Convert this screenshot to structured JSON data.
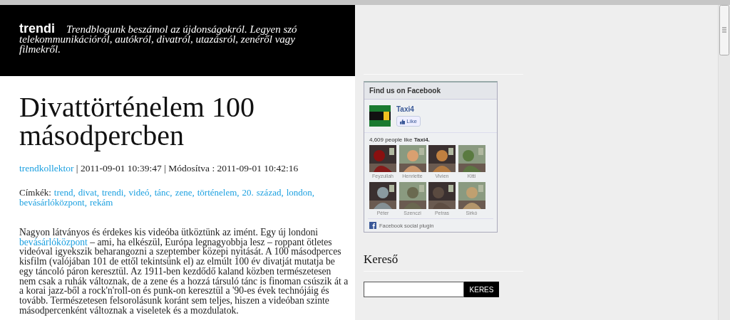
{
  "header": {
    "logo": "trendi",
    "tagline": [
      "Trendblogunk beszámol az újdonságokról. Legyen szó",
      "telekommunikációról, autókról, divatról, utazásról, zenéről vagy filmekről."
    ]
  },
  "post": {
    "title": "Divattörténelem 100 másodpercben",
    "author": "trendkollektor",
    "meta": " | 2011-09-01 10:39:47 | Módosítva : 2011-09-01 10:42:16",
    "tags_label": "Címkék:",
    "tags": [
      "trend,",
      "divat,",
      "trendi,",
      "videó,",
      "tánc,",
      "zene,",
      "történelem,",
      "20.",
      "század,",
      "london,",
      "bevásárlóközpont,",
      "rekám"
    ],
    "body": {
      "before": "Nagyon látványos és érdekes kis videóba ütköztünk az imént. Egy új londoni",
      "link": "bevásárlóközpont",
      "after": "– ami, ha elkészül, Európa legnagyobbja lesz – roppant ötletes videóval igyekszik beharangozni a szeptember közepi nyitását. A 100 másodperces kisfilm (valójában 101 de ettől tekintsünk el) az elmúlt 100 év divatját mutatja be egy táncoló páron keresztül. Az 1911-ben kezdődő kaland közben természetesen nem csak a ruhák változnak, de a zene és a hozzá társuló tánc is finoman csúszik át a a korai jazz-ből a rock'n'roll-on és punk-on keresztül a '90-es évek technójáig és tovább. Természetesen felsorolásunk koránt sem teljes, hiszen a videóban szinte másodpercenként változnak a viseletek és a mozdulatok."
    }
  },
  "facebook": {
    "title": "Find us on Facebook",
    "page": "Taxi4",
    "like": "Like",
    "count": "4,609 people like",
    "count_page": "Taxi4.",
    "friends": [
      {
        "name": "Feyzullah"
      },
      {
        "name": "Henriette"
      },
      {
        "name": "Vivien"
      },
      {
        "name": "Kitti"
      },
      {
        "name": "Péter"
      },
      {
        "name": "Szenczi"
      },
      {
        "name": "Petras"
      },
      {
        "name": "Sirkó"
      }
    ],
    "footer": "Facebook social plugin"
  },
  "search": {
    "title": "Kereső",
    "button": "KERES"
  }
}
